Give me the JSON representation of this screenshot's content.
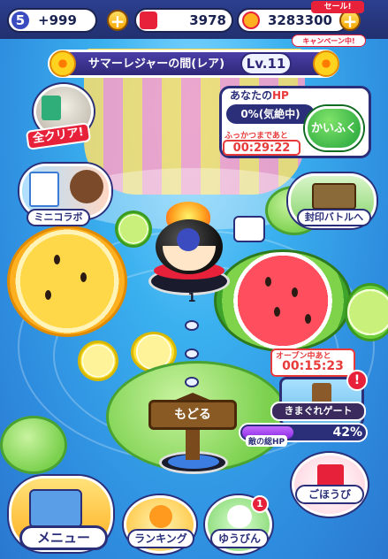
{
  "topbar": {
    "level": "5",
    "gems": "+999",
    "gems_plus": "+",
    "points": "3978",
    "coins": "3283300",
    "coins_plus": "+",
    "sale_badge": "セール!",
    "campaign_badge": "キャンペーン中!"
  },
  "stage": {
    "title": "サマーレジャーの間(レア)",
    "level": "Lv.11"
  },
  "hp": {
    "heading_prefix": "あなたの",
    "heading_hp": "HP",
    "value": "0%(気絶中)",
    "revive_label": "ふっかつまであと",
    "revive_timer": "00:29:22",
    "heal_button": "かいふく"
  },
  "left_menu": {
    "all_clear": "全クリア!",
    "mini_collab": "ミニコラボ"
  },
  "right_menu": {
    "seal_battle": "封印バトルへ"
  },
  "map": {
    "step_number": "1",
    "back_sign": "もどる"
  },
  "gate": {
    "open_label": "オープン中あと",
    "timer": "00:15:23",
    "name": "きまぐれゲート",
    "alert": "!",
    "enemy_hp_label": "敵の総HP",
    "enemy_hp_percent": "42%",
    "enemy_hp_fraction": 0.42
  },
  "bottom": {
    "menu": "メニュー",
    "ranking": "ランキング",
    "mail": "ゆうびん",
    "mail_badge": "1",
    "reward": "ごほうび"
  },
  "colors": {
    "accent_red": "#e8213a",
    "navy": "#2b2f7a",
    "heal_green": "#21a33a",
    "enemy_purple": "#8a2be2"
  }
}
